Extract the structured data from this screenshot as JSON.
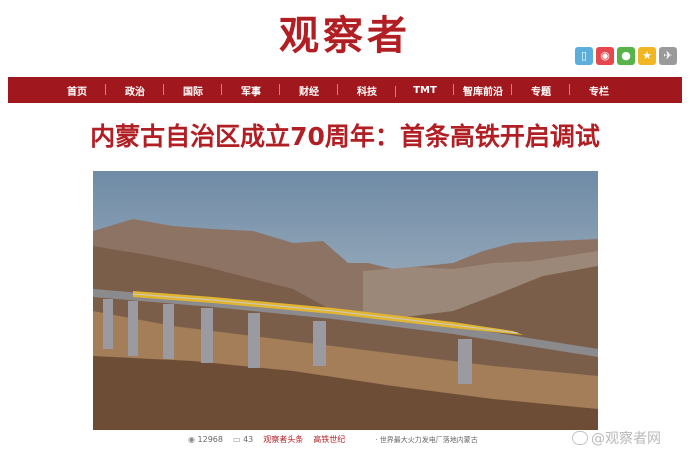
{
  "site": {
    "logo": "观察者"
  },
  "social_icons": [
    {
      "name": "mobile-icon",
      "glyph": "▯",
      "color": "#5aaedb"
    },
    {
      "name": "weibo-icon",
      "glyph": "◉",
      "color": "#e5474d"
    },
    {
      "name": "wechat-icon",
      "glyph": "●",
      "color": "#5ab24b"
    },
    {
      "name": "star-icon",
      "glyph": "★",
      "color": "#f2b523"
    },
    {
      "name": "share-icon",
      "glyph": "✈",
      "color": "#9a9a9a"
    }
  ],
  "nav": {
    "items": [
      "首页",
      "政治",
      "国际",
      "军事",
      "财经",
      "科技",
      "TMT",
      "智库前沿",
      "专题",
      "专栏"
    ]
  },
  "article": {
    "headline": "内蒙古自治区成立70周年：首条高铁开启调试"
  },
  "meta": {
    "views": "12968",
    "comments": "43",
    "tag1": "观察者头条",
    "tag2": "高铁世纪",
    "related": "· 世界最大火力发电厂落地内蒙古"
  },
  "watermark": {
    "text": "@观察者网"
  },
  "colors": {
    "brand": "#b11e23",
    "nav_bg": "#a0181d"
  }
}
